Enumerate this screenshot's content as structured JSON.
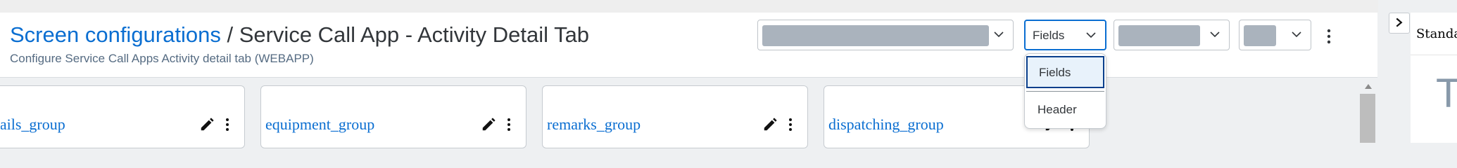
{
  "header": {
    "breadcrumb": "Screen configurations",
    "separator": " / ",
    "title": "Service Call App - Activity Detail Tab",
    "subtitle": "Configure Service Call Apps Activity detail tab (WEBAPP)"
  },
  "toolbar": {
    "view_select_value": "Fields",
    "view_options": [
      "Fields",
      "Header"
    ],
    "more_icon": "more-vertical-icon"
  },
  "right_panel": {
    "title": "Standard",
    "letter": "T",
    "expand_icon": "chevron-right-icon"
  },
  "cards": [
    {
      "name": "details_group"
    },
    {
      "name": "equipment_group"
    },
    {
      "name": "remarks_group"
    },
    {
      "name": "dispatching_group"
    }
  ],
  "colors": {
    "accent": "#0a6ed1",
    "text": "#32363a",
    "placeholder": "#aab3bd"
  }
}
